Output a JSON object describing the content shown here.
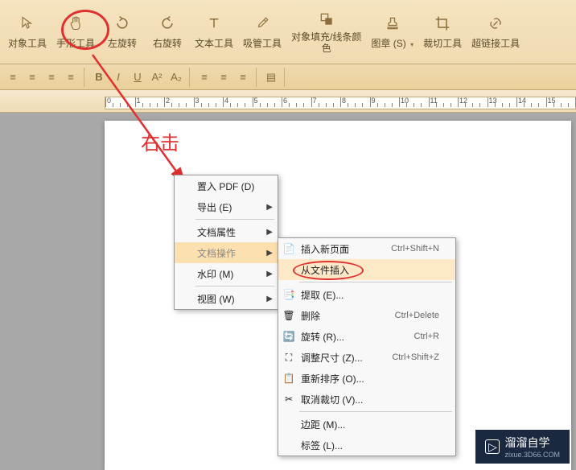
{
  "toolbar": {
    "items": [
      {
        "label": "对象工具",
        "icon": "cursor"
      },
      {
        "label": "手形工具",
        "icon": "hand"
      },
      {
        "label": "左旋转",
        "icon": "rotate-left"
      },
      {
        "label": "右旋转",
        "icon": "rotate-right"
      },
      {
        "label": "文本工具",
        "icon": "text"
      },
      {
        "label": "吸管工具",
        "icon": "eyedropper"
      },
      {
        "label": "对象填充/线条颜\n色",
        "icon": "fill"
      },
      {
        "label": "图章 (S)",
        "icon": "stamp",
        "dropdown": true
      },
      {
        "label": "裁切工具",
        "icon": "crop"
      },
      {
        "label": "超链接工具",
        "icon": "link"
      }
    ]
  },
  "secondary": {
    "align": [
      "left",
      "center",
      "right",
      "justify"
    ],
    "format": {
      "B": "B",
      "I": "I",
      "U": "U",
      "sup": "A²",
      "sub": "A₂"
    }
  },
  "annotation": {
    "label": "右击"
  },
  "context1": {
    "items": [
      {
        "label": "置入 PDF (D)"
      },
      {
        "label": "导出 (E)",
        "sub": true
      },
      {
        "sep": true
      },
      {
        "label": "文档属性",
        "sub": true
      },
      {
        "label": "文档操作",
        "sub": true,
        "highlighted": true
      },
      {
        "label": "水印 (M)",
        "sub": true
      },
      {
        "sep": true
      },
      {
        "label": "视图 (W)",
        "sub": true
      }
    ]
  },
  "context2": {
    "items": [
      {
        "label": "插入新页面",
        "shortcut": "Ctrl+Shift+N",
        "icon": "page-add"
      },
      {
        "label": "从文件插入",
        "active": true
      },
      {
        "sep": true
      },
      {
        "label": "提取 (E)...",
        "icon": "extract"
      },
      {
        "label": "删除",
        "shortcut": "Ctrl+Delete",
        "icon": "delete"
      },
      {
        "label": "旋转 (R)...",
        "shortcut": "Ctrl+R",
        "icon": "rotate"
      },
      {
        "label": "调整尺寸 (Z)...",
        "shortcut": "Ctrl+Shift+Z",
        "icon": "resize"
      },
      {
        "label": "重新排序 (O)...",
        "icon": "reorder"
      },
      {
        "label": "取消裁切 (V)...",
        "icon": "uncrop"
      },
      {
        "sep": true
      },
      {
        "label": "边距 (M)..."
      },
      {
        "label": "标签 (L)..."
      }
    ]
  },
  "watermark": {
    "title": "溜溜自学",
    "sub": "zixue.3D66.COM"
  }
}
